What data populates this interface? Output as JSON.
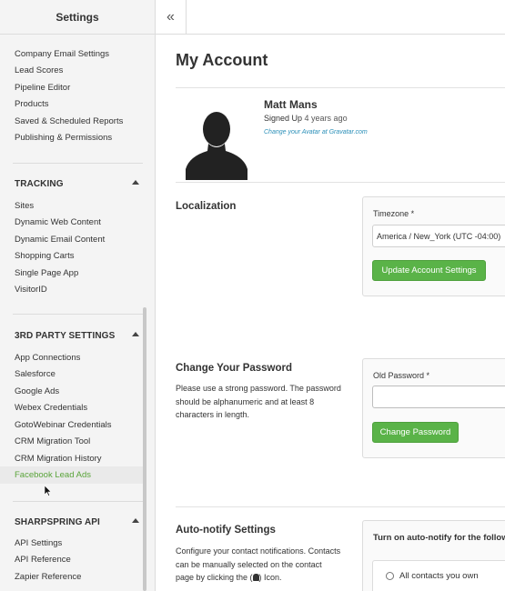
{
  "sidebar": {
    "title": "Settings",
    "links_top": [
      "Company Email Settings",
      "Lead Scores",
      "Pipeline Editor",
      "Products",
      "Saved & Scheduled Reports",
      "Publishing & Permissions"
    ],
    "tracking": {
      "title": "TRACKING",
      "items": [
        "Sites",
        "Dynamic Web Content",
        "Dynamic Email Content",
        "Shopping Carts",
        "Single Page App",
        "VisitorID"
      ]
    },
    "third_party": {
      "title": "3RD PARTY SETTINGS",
      "items": [
        "App Connections",
        "Salesforce",
        "Google Ads",
        "Webex Credentials",
        "GotoWebinar Credentials",
        "CRM Migration Tool",
        "CRM Migration History",
        "Facebook Lead Ads"
      ],
      "active": "Facebook Lead Ads"
    },
    "api": {
      "title": "SHARPSPRING API",
      "items": [
        "API Settings",
        "API Reference",
        "Zapier Reference"
      ]
    }
  },
  "topbar": {
    "collapse_icon": "«"
  },
  "main": {
    "title": "My Account",
    "user": {
      "name": "Matt Mans",
      "signed_prefix": "Signed Up",
      "signed_time": "4 years ago",
      "gravatar_link": "Change your Avatar at Gravatar.com"
    },
    "localization": {
      "title": "Localization",
      "timezone_label": "Timezone *",
      "timezone_value": "America / New_York (UTC -04:00)",
      "button": "Update Account Settings"
    },
    "password": {
      "title": "Change Your Password",
      "description": "Please use a strong password. The password should be alphanumeric and at least 8 characters in length.",
      "old_label": "Old Password *",
      "button": "Change Password"
    },
    "autonotify": {
      "title": "Auto-notify Settings",
      "description_1": "Configure your contact notifications. Contacts can be manually selected on the contact page by clicking the (",
      "description_2": ") Icon.",
      "panel_header": "Turn on auto-notify for the following",
      "option_1": "All contacts you own"
    }
  },
  "colors": {
    "accent_green": "#5ab348",
    "link_blue": "#2a8fb8",
    "active_link": "#5aa43a"
  }
}
